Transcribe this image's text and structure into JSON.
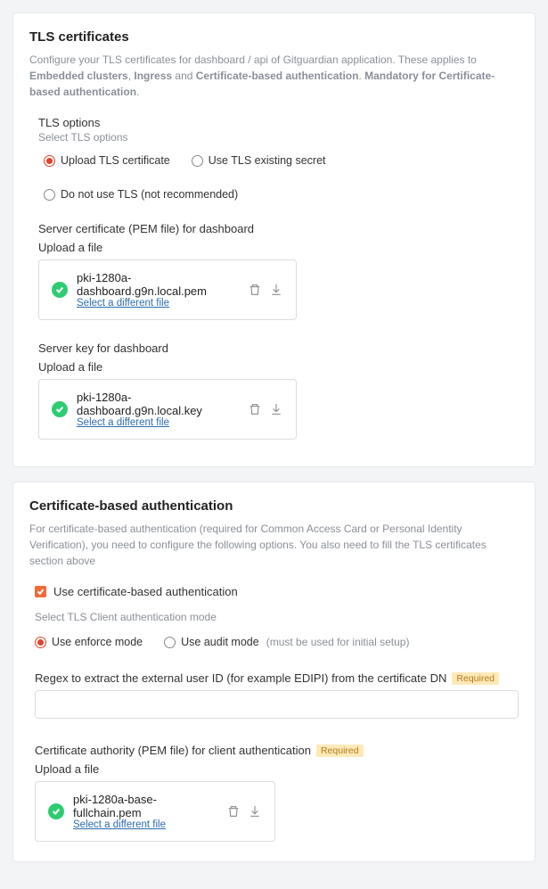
{
  "tls": {
    "title": "TLS certificates",
    "desc_pre": "Configure your TLS certificates for dashboard / api of Gitguardian application. These applies to ",
    "desc_b1": "Embedded clusters",
    "desc_mid": ", ",
    "desc_b2": "Ingress",
    "desc_mid2": " and ",
    "desc_b3": "Certificate-based authentication",
    "desc_post": ". ",
    "desc_b4": "Mandatory for Certificate-based authentication",
    "desc_end": ".",
    "options": {
      "title": "TLS options",
      "hint": "Select TLS options",
      "items": [
        "Upload TLS certificate",
        "Use TLS existing secret",
        "Do not use TLS (not recommended)"
      ]
    },
    "server_cert": {
      "label": "Server certificate (PEM file) for dashboard",
      "upload_label": "Upload a file",
      "file": "pki-1280a-dashboard.g9n.local.pem",
      "select_link": "Select a different file"
    },
    "server_key": {
      "label": "Server key for dashboard",
      "upload_label": "Upload a file",
      "file": "pki-1280a-dashboard.g9n.local.key",
      "select_link": "Select a different file"
    }
  },
  "cba": {
    "title": "Certificate-based authentication",
    "desc": "For certificate-based authentication (required for Common Access Card or Personal Identity Verification), you need to configure the following options. You also need to fill the TLS certificates section above",
    "checkbox_label": "Use certificate-based authentication",
    "mode_hint": "Select TLS Client authentication mode",
    "modes": {
      "enforce": "Use enforce mode",
      "audit": "Use audit mode",
      "audit_note": "(must be used for initial setup)"
    },
    "regex": {
      "label": "Regex to extract the external user ID (for example EDIPI) from the certificate DN",
      "required": "Required",
      "value": ""
    },
    "ca": {
      "label": "Certificate authority (PEM file) for client authentication",
      "required": "Required",
      "upload_label": "Upload a file",
      "file": "pki-1280a-base-fullchain.pem",
      "select_link": "Select a different file"
    }
  }
}
